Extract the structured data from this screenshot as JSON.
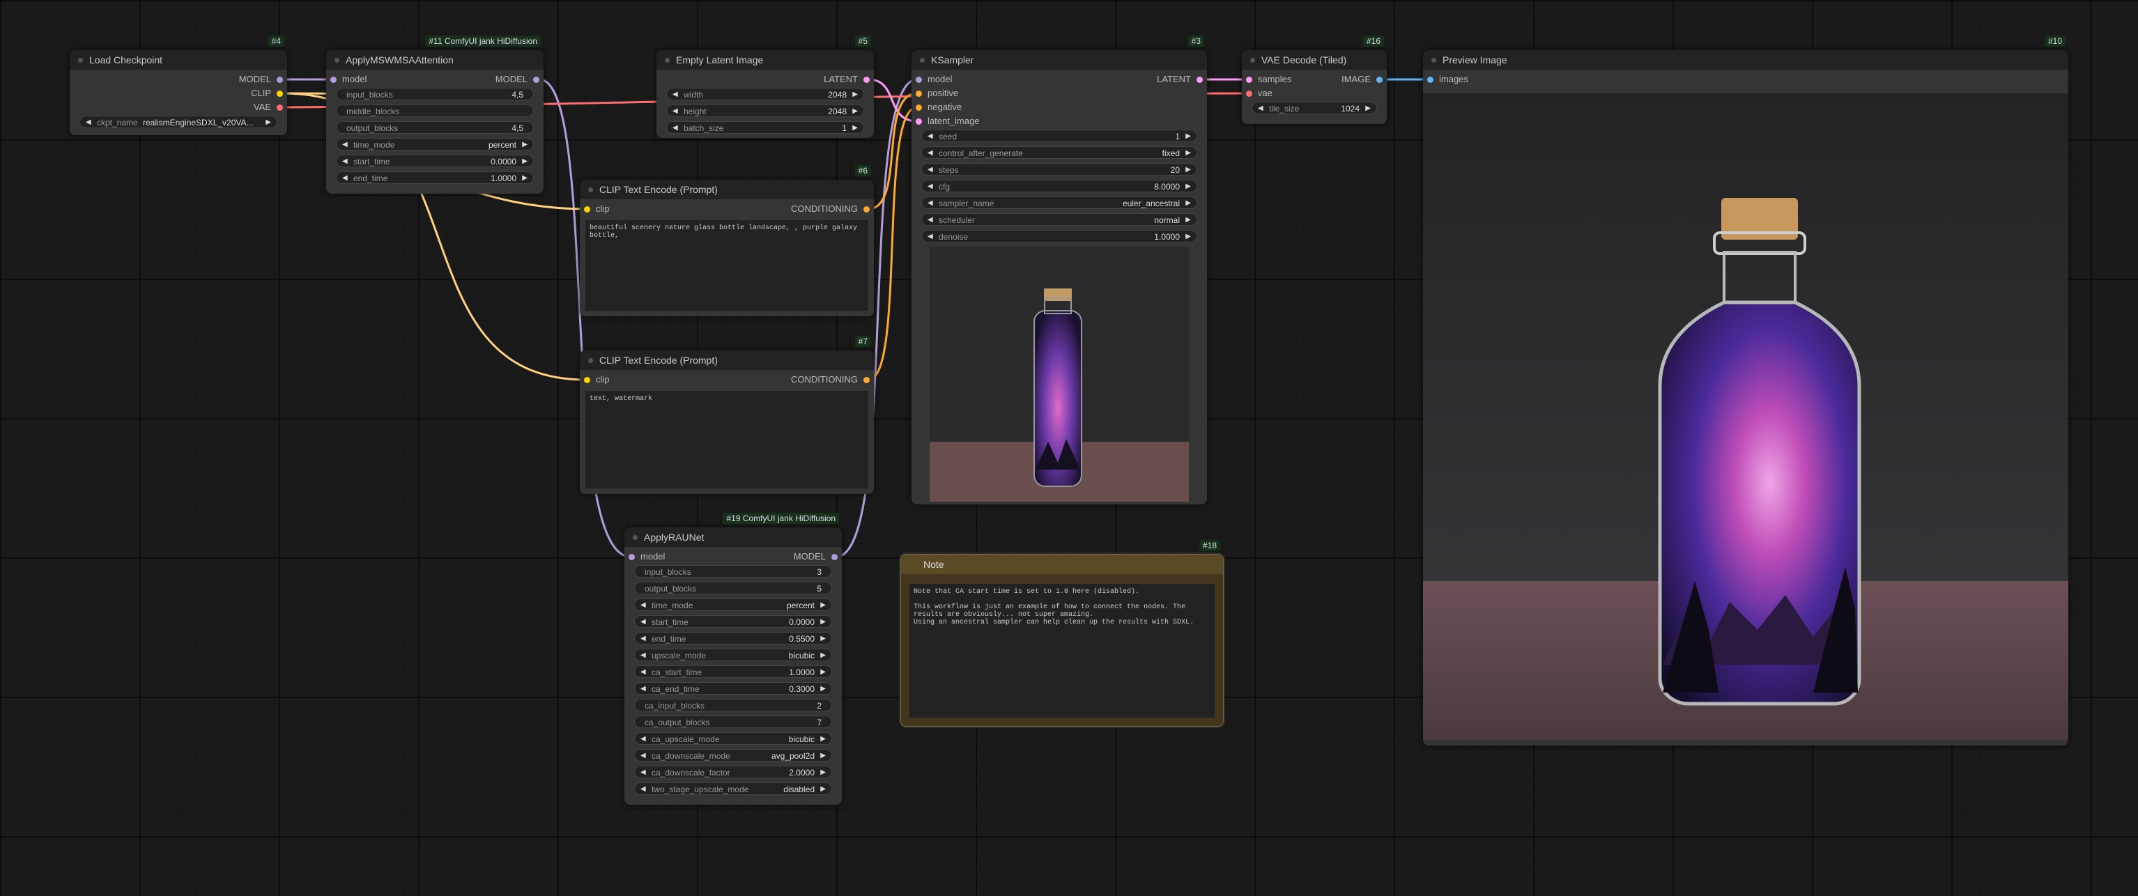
{
  "nodes": {
    "load_checkpoint": {
      "badge": "#4",
      "title": "Load Checkpoint",
      "outputs": [
        "MODEL",
        "CLIP",
        "VAE"
      ],
      "widget": {
        "label": "ckpt_name",
        "value": "realismEngineSDXL_v20VA..."
      }
    },
    "apply_msw": {
      "badge": "#11 ComfyUI jank HiDiffusion",
      "title": "ApplyMSWMSAAttention",
      "input": "model",
      "output": "MODEL",
      "widgets": [
        {
          "label": "input_blocks",
          "value": "4,5",
          "arrows": false
        },
        {
          "label": "middle_blocks",
          "value": "",
          "arrows": false
        },
        {
          "label": "output_blocks",
          "value": "4,5",
          "arrows": false
        },
        {
          "label": "time_mode",
          "value": "percent",
          "arrows": true
        },
        {
          "label": "start_time",
          "value": "0.0000",
          "arrows": true
        },
        {
          "label": "end_time",
          "value": "1.0000",
          "arrows": true
        }
      ]
    },
    "empty_latent": {
      "badge": "#5",
      "title": "Empty Latent Image",
      "output": "LATENT",
      "widgets": [
        {
          "label": "width",
          "value": "2048",
          "arrows": true
        },
        {
          "label": "height",
          "value": "2048",
          "arrows": true
        },
        {
          "label": "batch_size",
          "value": "1",
          "arrows": true
        }
      ]
    },
    "clip_pos": {
      "badge": "#6",
      "title": "CLIP Text Encode (Prompt)",
      "input": "clip",
      "output": "CONDITIONING",
      "text": "beautiful scenery nature glass bottle landscape, , purple galaxy bottle,"
    },
    "clip_neg": {
      "badge": "#7",
      "title": "CLIP Text Encode (Prompt)",
      "input": "clip",
      "output": "CONDITIONING",
      "text": "text, watermark"
    },
    "ksampler": {
      "badge": "#3",
      "title": "KSampler",
      "inputs": [
        "model",
        "positive",
        "negative",
        "latent_image"
      ],
      "output": "LATENT",
      "widgets": [
        {
          "label": "seed",
          "value": "1",
          "arrows": true
        },
        {
          "label": "control_after_generate",
          "value": "fixed",
          "arrows": true
        },
        {
          "label": "steps",
          "value": "20",
          "arrows": true
        },
        {
          "label": "cfg",
          "value": "8.0000",
          "arrows": true
        },
        {
          "label": "sampler_name",
          "value": "euler_ancestral",
          "arrows": true
        },
        {
          "label": "scheduler",
          "value": "normal",
          "arrows": true
        },
        {
          "label": "denoise",
          "value": "1.0000",
          "arrows": true
        }
      ]
    },
    "vae_decode": {
      "badge": "#16",
      "title": "VAE Decode (Tiled)",
      "inputs": [
        "samples",
        "vae"
      ],
      "output": "IMAGE",
      "widget": {
        "label": "tile_size",
        "value": "1024"
      }
    },
    "preview": {
      "badge": "#10",
      "title": "Preview Image",
      "input": "images"
    },
    "rau": {
      "badge": "#19 ComfyUI jank HiDiffusion",
      "title": "ApplyRAUNet",
      "input": "model",
      "output": "MODEL",
      "widgets": [
        {
          "label": "input_blocks",
          "value": "3",
          "arrows": false
        },
        {
          "label": "output_blocks",
          "value": "5",
          "arrows": false
        },
        {
          "label": "time_mode",
          "value": "percent",
          "arrows": true
        },
        {
          "label": "start_time",
          "value": "0.0000",
          "arrows": true
        },
        {
          "label": "end_time",
          "value": "0.5500",
          "arrows": true
        },
        {
          "label": "upscale_mode",
          "value": "bicubic",
          "arrows": true
        },
        {
          "label": "ca_start_time",
          "value": "1.0000",
          "arrows": true
        },
        {
          "label": "ca_end_time",
          "value": "0.3000",
          "arrows": true
        },
        {
          "label": "ca_input_blocks",
          "value": "2",
          "arrows": false
        },
        {
          "label": "ca_output_blocks",
          "value": "7",
          "arrows": false
        },
        {
          "label": "ca_upscale_mode",
          "value": "bicubic",
          "arrows": true
        },
        {
          "label": "ca_downscale_mode",
          "value": "avg_pool2d",
          "arrows": true
        },
        {
          "label": "ca_downscale_factor",
          "value": "2.0000",
          "arrows": true
        },
        {
          "label": "two_stage_upscale_mode",
          "value": "disabled",
          "arrows": true
        }
      ]
    },
    "note": {
      "badge": "#18",
      "title": "Note",
      "text": "Note that CA start time is set to 1.0 here (disabled).\n\nThis workflow is just an example of how to connect the nodes. The results are obviously... not super amazing.\nUsing an ancestral sampler can help clean up the results with SDXL."
    }
  },
  "colors": {
    "model": "#b39ddb",
    "clip": "#ffd500",
    "vae": "#ff6e6e",
    "latent": "#ff9cf9",
    "conditioning": "#ffa931",
    "image": "#64b5f6"
  }
}
